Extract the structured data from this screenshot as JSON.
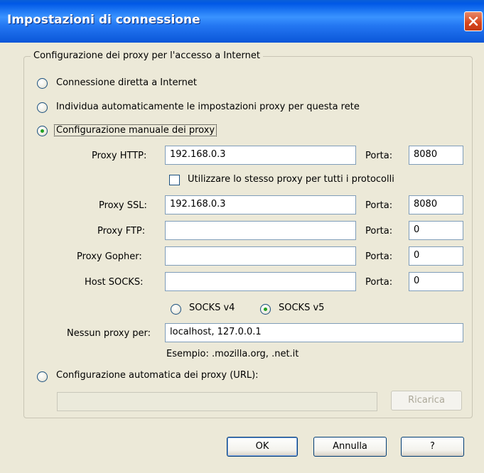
{
  "window": {
    "title": "Impostazioni di connessione"
  },
  "group": {
    "legend": "Configurazione dei proxy per l'accesso a Internet"
  },
  "options": {
    "direct": "Connessione diretta a Internet",
    "auto_detect": "Individua automaticamente le impostazioni proxy per questa rete",
    "manual": "Configurazione manuale dei proxy",
    "auto_url": "Configurazione automatica dei proxy (URL):",
    "selected": "manual"
  },
  "manual": {
    "http": {
      "label": "Proxy HTTP:",
      "value": "192.168.0.3",
      "port_label": "Porta:",
      "port": "8080"
    },
    "same_proxy_label": "Utilizzare lo stesso proxy per tutti i protocolli",
    "same_proxy_checked": false,
    "ssl": {
      "label": "Proxy SSL:",
      "value": "192.168.0.3",
      "port_label": "Porta:",
      "port": "8080"
    },
    "ftp": {
      "label": "Proxy FTP:",
      "value": "",
      "port_label": "Porta:",
      "port": "0"
    },
    "gopher": {
      "label": "Proxy Gopher:",
      "value": "",
      "port_label": "Porta:",
      "port": "0"
    },
    "socks": {
      "label": "Host SOCKS:",
      "value": "",
      "port_label": "Porta:",
      "port": "0"
    },
    "socks_v4": "SOCKS v4",
    "socks_v5": "SOCKS v5",
    "socks_selected": "v5",
    "no_proxy_label": "Nessun proxy per:",
    "no_proxy_value": "localhost, 127.0.0.1",
    "example": "Esempio: .mozilla.org, .net.it"
  },
  "auto": {
    "url_value": "",
    "reload_label": "Ricarica"
  },
  "buttons": {
    "ok": "OK",
    "cancel": "Annulla",
    "help": "?"
  }
}
